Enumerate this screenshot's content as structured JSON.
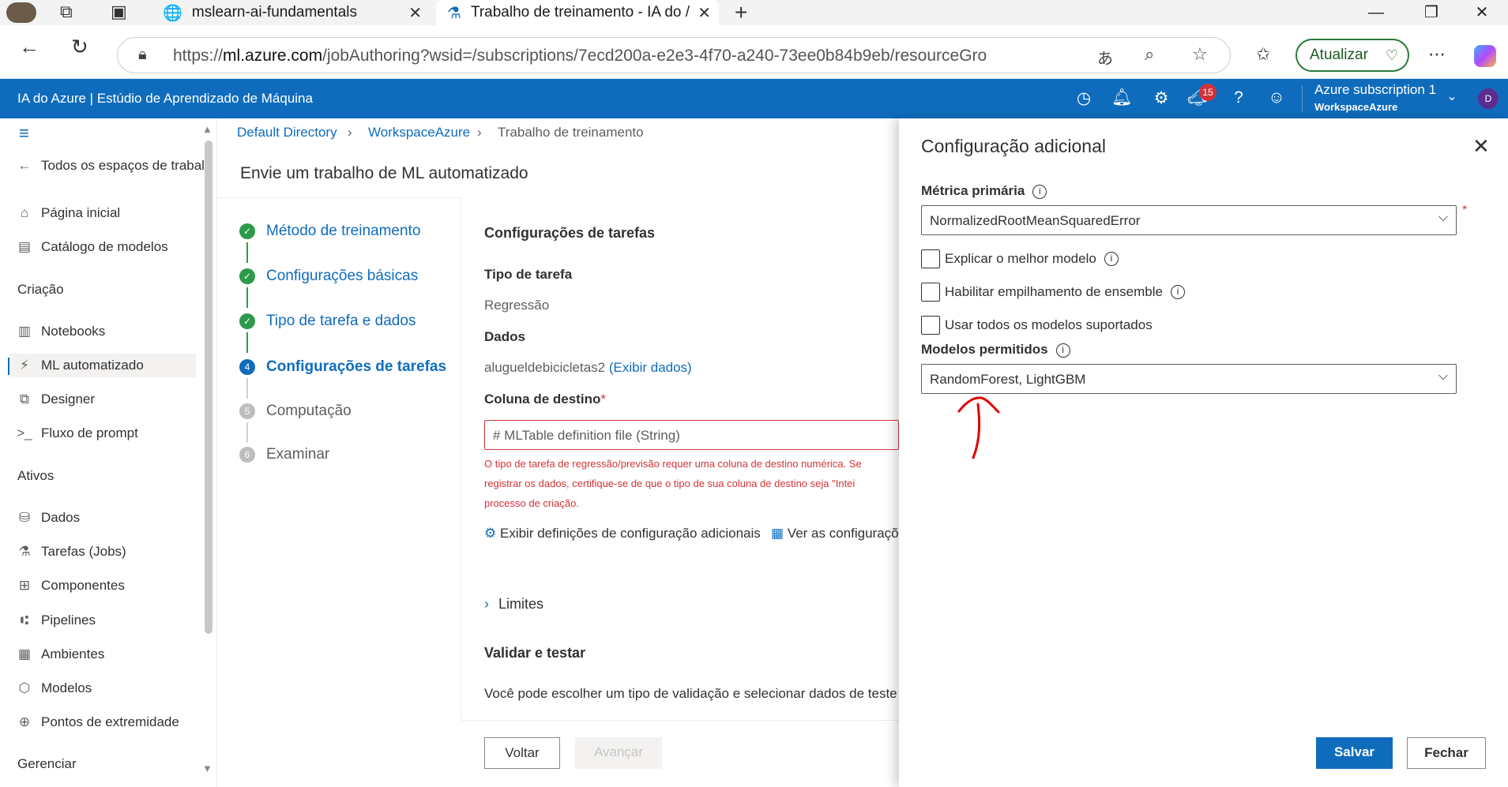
{
  "browser": {
    "tabs": [
      {
        "label": "mslearn-ai-fundamentals"
      },
      {
        "label": "Trabalho de treinamento - IA do /"
      }
    ],
    "url_prefix": "https://",
    "url_host": "ml.azure.com",
    "url_rest": "/jobAuthoring?wsid=/subscriptions/7ecd200a-e2e3-4f70-a240-73ee0b84b9eb/resourceGroups/dani...",
    "update_label": "Atualizar"
  },
  "azure": {
    "title": "IA do Azure | Estúdio de Aprendizado de Máquina",
    "notification_count": "15",
    "subscription": "Azure subscription 1",
    "workspace": "WorkspaceAzure",
    "avatar_initial": "D"
  },
  "nav": {
    "back": "Todos os espaços de trabal",
    "home": "Página inicial",
    "catalog": "Catálogo de modelos",
    "section_create": "Criação",
    "notebooks": "Notebooks",
    "automl": "ML automatizado",
    "designer": "Designer",
    "promptflow": "Fluxo de prompt",
    "section_assets": "Ativos",
    "data": "Dados",
    "jobs": "Tarefas (Jobs)",
    "components": "Componentes",
    "pipelines": "Pipelines",
    "environments": "Ambientes",
    "models": "Modelos",
    "endpoints": "Pontos de extremidade",
    "section_manage": "Gerenciar"
  },
  "breadcrumb": {
    "dir": "Default Directory",
    "workspace": "WorkspaceAzure",
    "current": "Trabalho de treinamento"
  },
  "page_title": "Envie um trabalho de ML automatizado",
  "steps": [
    {
      "label": "Método de treinamento",
      "status": "done"
    },
    {
      "label": "Configurações básicas",
      "status": "done"
    },
    {
      "label": "Tipo de tarefa e dados",
      "status": "done"
    },
    {
      "label": "Configurações de tarefas",
      "status": "current",
      "num": "4"
    },
    {
      "label": "Computação",
      "status": "pending",
      "num": "5"
    },
    {
      "label": "Examinar",
      "status": "pending",
      "num": "6"
    }
  ],
  "content": {
    "heading": "Configurações de tarefas",
    "task_type_label": "Tipo de tarefa",
    "task_type_value": "Regressão",
    "data_label": "Dados",
    "data_value": "alugueldebicicletas2",
    "data_link": "(Exibir dados)",
    "target_label": "Coluna de destino",
    "target_placeholder": "# MLTable definition file (String)",
    "error_line1": "O tipo de tarefa de regressão/previsão requer uma coluna de destino numérica. Se",
    "error_line2": "registrar os dados, certifique-se de que o tipo de sua coluna de destino seja \"Intei",
    "error_line3": "processo de criação.",
    "extra_config_link": "Exibir definições de configuração adicionais",
    "featurization_link": "Ver as configuraçõ",
    "limits": "Limites",
    "validate_heading": "Validar e testar",
    "validate_text": "Você pode escolher um tipo de validação e selecionar dados de teste c",
    "back_button": "Voltar",
    "next_button": "Avançar"
  },
  "panel": {
    "title": "Configuração adicional",
    "primary_metric_label": "Métrica primária",
    "primary_metric_value": "NormalizedRootMeanSquaredError",
    "explain_best": "Explicar o melhor modelo",
    "ensemble": "Habilitar empilhamento de ensemble",
    "use_all": "Usar todos os modelos suportados",
    "allowed_models_label": "Modelos permitidos",
    "allowed_models_value": "RandomForest, LightGBM",
    "save": "Salvar",
    "close": "Fechar"
  },
  "colors": {
    "azure_blue": "#0f6cbd",
    "success_green": "#2d9a4b",
    "error_red": "#d13438",
    "annotation_red": "#e00000"
  }
}
